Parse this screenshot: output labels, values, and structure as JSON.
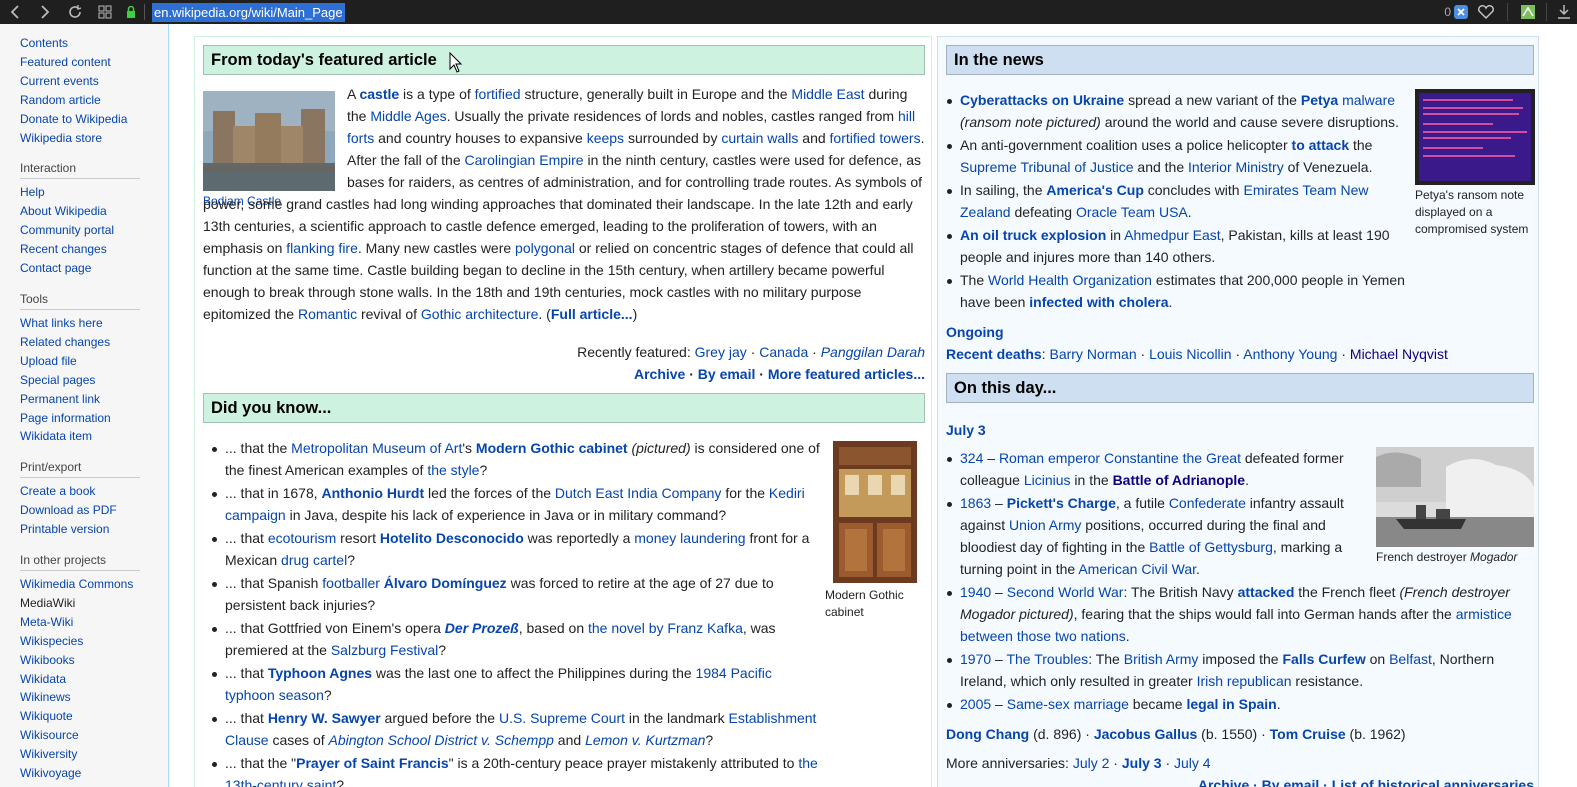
{
  "browser": {
    "url": "en.wikipedia.org/wiki/Main_Page",
    "tab_count": "0"
  },
  "sidebar": {
    "main": [
      "Contents",
      "Featured content",
      "Current events",
      "Random article",
      "Donate to Wikipedia",
      "Wikipedia store"
    ],
    "interaction": {
      "title": "Interaction",
      "items": [
        "Help",
        "About Wikipedia",
        "Community portal",
        "Recent changes",
        "Contact page"
      ]
    },
    "tools": {
      "title": "Tools",
      "items": [
        "What links here",
        "Related changes",
        "Upload file",
        "Special pages",
        "Permanent link",
        "Page information",
        "Wikidata item"
      ]
    },
    "print": {
      "title": "Print/export",
      "items": [
        "Create a book",
        "Download as PDF",
        "Printable version"
      ]
    },
    "other": {
      "title": "In other projects",
      "items": [
        "Wikimedia Commons",
        "MediaWiki",
        "Meta-Wiki",
        "Wikispecies",
        "Wikibooks",
        "Wikidata",
        "Wikinews",
        "Wikiquote",
        "Wikisource",
        "Wikiversity",
        "Wikivoyage"
      ]
    }
  },
  "featured": {
    "heading": "From today's featured article",
    "image_caption": "Bodiam Castle",
    "recently_featured_label": "Recently featured:",
    "recent": [
      "Grey jay",
      "Canada",
      "Panggilan Darah"
    ],
    "links": [
      "Archive",
      "By email",
      "More featured articles..."
    ]
  },
  "dyk": {
    "heading": "Did you know...",
    "image_caption": "Modern Gothic cabinet"
  },
  "news": {
    "heading": "In the news",
    "image_caption": "Petya's ransom note displayed on a compromised system",
    "ongoing_label": "Ongoing",
    "recent_deaths_label": "Recent deaths",
    "deaths": [
      "Barry Norman",
      "Louis Nicollin",
      "Anthony Young",
      "Michael Nyqvist"
    ]
  },
  "otd": {
    "heading": "On this day...",
    "date": "July 3",
    "image_caption_prefix": "French destroyer ",
    "image_caption_italic": "Mogador",
    "more_label": "More anniversaries:",
    "more": [
      "July 2",
      "July 3",
      "July 4"
    ],
    "bottom_links": "Archive · By email · List of historical anniversaries"
  },
  "colors": {
    "link": "#0645ad",
    "green_header": "#cef2e0",
    "blue_header": "#cedff2"
  }
}
